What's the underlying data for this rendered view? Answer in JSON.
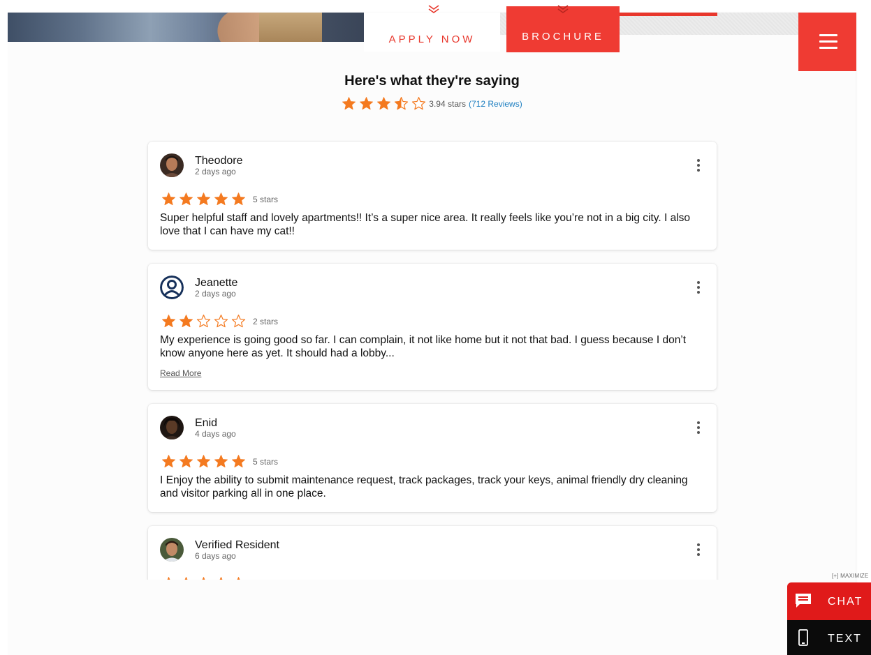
{
  "header": {
    "apply_label": "APPLY NOW",
    "brochure_label": "BROCHURE",
    "accent_color": "#ef3b33"
  },
  "summary": {
    "title": "Here's what they're saying",
    "rating": 3.94,
    "stars_text": "3.94 stars",
    "reviews_link": "(712 Reviews)",
    "star_color": "#f47a20"
  },
  "reviews": [
    {
      "name": "Theodore",
      "date": "2 days ago",
      "rating": 5,
      "stars_text": "5 stars",
      "text": "Super helpful staff and lovely apartments!! It’s a super nice area. It really feels like you’re not in a big city. I also love that I can have my cat!!",
      "avatar": "photo"
    },
    {
      "name": "Jeanette",
      "date": "2 days ago",
      "rating": 2,
      "stars_text": "2 stars",
      "text": "My experience is going good so far. I can complain, it not like home but it not that bad. I guess because I don’t know anyone here as yet. It should had a lobby...",
      "read_more": "Read More",
      "avatar": "default-user-icon"
    },
    {
      "name": "Enid",
      "date": "4 days ago",
      "rating": 5,
      "stars_text": "5 stars",
      "text": "I Enjoy the ability to submit maintenance request, track packages, track your keys, animal friendly dry cleaning and  visitor parking all in one place.",
      "avatar": "photo"
    },
    {
      "name": "Verified Resident",
      "date": "6 days ago",
      "rating": 5,
      "avatar": "photo"
    }
  ],
  "chat_widget": {
    "maximize_label": "[+] MAXIMIZE",
    "chat_label": "CHAT",
    "text_label": "TEXT",
    "chat_color": "#e01a1a",
    "text_color": "#0b0b0b"
  }
}
